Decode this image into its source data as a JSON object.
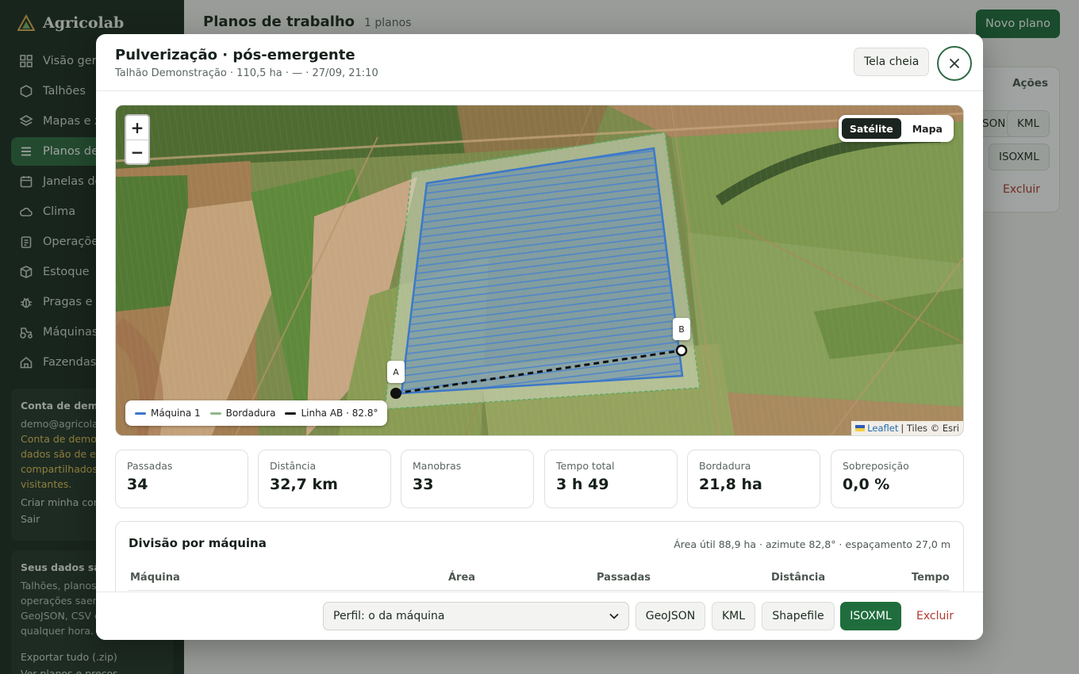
{
  "app": {
    "name": "Agricolab"
  },
  "sidebar": {
    "items": [
      {
        "label": "Visão geral",
        "icon": "grid-icon"
      },
      {
        "label": "Talhões",
        "icon": "hexagon-icon"
      },
      {
        "label": "Mapas e zonas",
        "icon": "layers-icon"
      },
      {
        "label": "Planos de trabalho",
        "icon": "list-icon",
        "active": true
      },
      {
        "label": "Janelas de aplicação",
        "icon": "calendar-icon"
      },
      {
        "label": "Clima",
        "icon": "cloud-icon"
      },
      {
        "label": "Operações",
        "icon": "clipboard-icon"
      },
      {
        "label": "Estoque",
        "icon": "box-icon"
      },
      {
        "label": "Pragas e doenças",
        "icon": "bug-icon"
      },
      {
        "label": "Máquinas",
        "icon": "tractor-icon"
      },
      {
        "label": "Fazendas",
        "icon": "home-icon"
      }
    ],
    "account_card": {
      "title": "Conta de demonstração",
      "email": "demo@agricolab",
      "lines": [
        "Conta de demonstração: os",
        "dados são de exemplo e",
        "compartilhados entre",
        "visitantes."
      ],
      "create_link": "Criar minha conta",
      "logout_link": "Sair"
    },
    "data_card": {
      "title": "Seus dados são seus",
      "lines": [
        "Talhões, planos e",
        "operações saem em",
        "GeoJSON, CSV e KML a",
        "qualquer hora."
      ],
      "export_link": "Exportar tudo (.zip)",
      "plans_link": "Ver planos e preços"
    }
  },
  "header": {
    "title": "Planos de trabalho",
    "count": "1 planos",
    "new_button": "Novo plano"
  },
  "background_table": {
    "actions_header": "Ações",
    "buttons": [
      "GeoJSON",
      "KML",
      "ISOXML"
    ],
    "delete": "Excluir"
  },
  "modal": {
    "title": "Pulverização · pós-emergente",
    "subtitle": "Talhão Demonstração · 110,5 ha · — · 27/09, 21:10",
    "fullscreen_button": "Tela cheia",
    "map": {
      "zoom_in": "+",
      "zoom_out": "−",
      "layers": {
        "satellite": "Satélite",
        "map": "Mapa",
        "selected": "Satélite"
      },
      "legend": [
        {
          "label": "Máquina 1",
          "color": "#3b78c8"
        },
        {
          "label": "Bordadura",
          "color": "#8fb88a"
        },
        {
          "label": "Linha AB · 82.8°",
          "color": "#111111"
        }
      ],
      "marker_a": "A",
      "marker_b": "B",
      "attribution_link": "Leaflet",
      "attribution_text": "| Tiles © Esri",
      "ab_azimuth_deg": 82.8
    },
    "stats": [
      {
        "label": "Passadas",
        "value": "34"
      },
      {
        "label": "Distância",
        "value": "32,7 km"
      },
      {
        "label": "Manobras",
        "value": "33"
      },
      {
        "label": "Tempo total",
        "value": "3 h 49"
      },
      {
        "label": "Bordadura",
        "value": "21,8 ha"
      },
      {
        "label": "Sobreposição",
        "value": "0,0 %"
      }
    ],
    "division": {
      "title": "Divisão por máquina",
      "meta": "Área útil 88,9 ha · azimute 82,8° · espaçamento 27,0 m",
      "columns": [
        "Máquina",
        "Área",
        "Passadas",
        "Distância",
        "Tempo"
      ]
    },
    "footer": {
      "profile_select": "Perfil: o da máquina",
      "buttons": [
        "GeoJSON",
        "KML",
        "Shapefile",
        "ISOXML"
      ],
      "delete": "Excluir"
    }
  },
  "colors": {
    "sidebar_bg": "#1d2e22",
    "accent": "#1f6d3d",
    "danger": "#b03a2e",
    "coverage": "#3b78c8",
    "headland": "#8fb88a"
  }
}
